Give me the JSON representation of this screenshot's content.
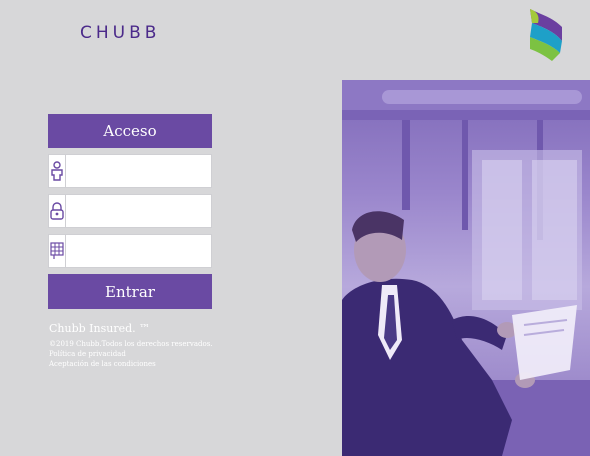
{
  "brand": {
    "name": "CHUBB"
  },
  "login": {
    "title": "Acceso",
    "username_placeholder": "",
    "password_placeholder": "",
    "keypad_placeholder": "",
    "submit_label": "Entrar"
  },
  "footer": {
    "tagline": "Chubb Insured. ™",
    "copyright": "©2019 Chubb.Todos los derechos reservados.",
    "privacy_link": "Política de privacidad",
    "terms_link": "Aceptación de las condiciones"
  },
  "icons": {
    "user": "user-icon",
    "lock": "lock-icon",
    "keypad": "keypad-icon"
  },
  "colors": {
    "accent": "#6a4aa3",
    "brand": "#4b2a8a",
    "background": "#d7d7d9"
  }
}
